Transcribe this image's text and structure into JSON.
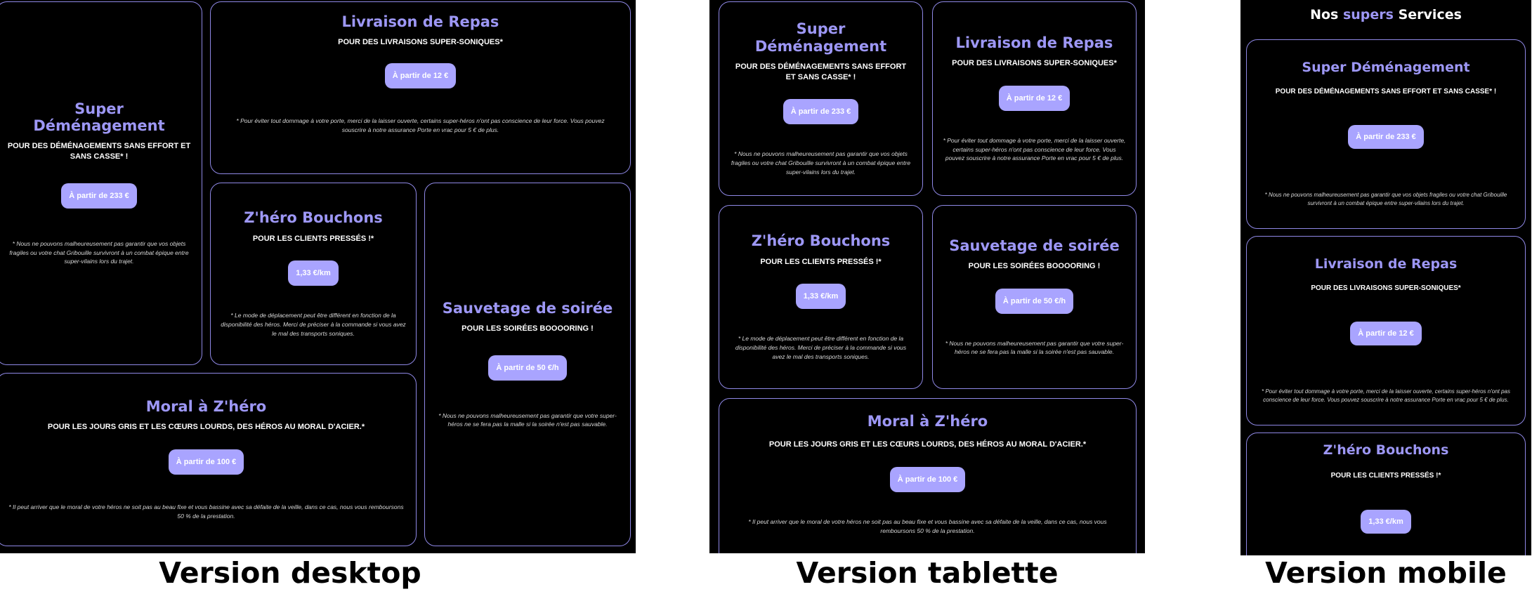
{
  "services": {
    "demenagement": {
      "title": "Super Déménagement",
      "subtitle": "POUR DES DÉMÉNAGEMENTS SANS EFFORT ET SANS CASSE* !",
      "price": "À partir de 233 €",
      "note": "* Nous ne pouvons malheureusement pas garantir que vos objets fragiles ou votre chat Gribouille survivront à un combat épique entre super-vilains lors du trajet."
    },
    "livraison": {
      "title": "Livraison de Repas",
      "subtitle": "POUR DES LIVRAISONS SUPER-SONIQUES*",
      "price": "À partir de 12 €",
      "note": "* Pour éviter tout dommage à votre porte, merci de la laisser ouverte, certains super-héros n'ont pas conscience de leur force. Vous pouvez souscrire à notre assurance Porte en vrac pour 5 € de plus."
    },
    "bouchons": {
      "title": "Z'héro Bouchons",
      "subtitle": "POUR LES CLIENTS PRESSÉS !*",
      "price": "1,33 €/km",
      "note": "* Le mode de déplacement peut être différent en fonction de la disponibilité des héros. Merci de préciser à la commande si vous avez le mal des transports soniques."
    },
    "soiree": {
      "title": "Sauvetage de soirée",
      "subtitle": "POUR LES SOIRÉES BOOOORING !",
      "price": "À partir de 50 €/h",
      "note": "* Nous ne pouvons malheureusement pas garantir que votre super-héros ne se fera pas la malle si la soirée n'est pas sauvable."
    },
    "moral": {
      "title": "Moral à Z'héro",
      "subtitle": "POUR LES JOURS GRIS ET LES CŒURS LOURDS, DES HÉROS AU MORAL D'ACIER.*",
      "price": "À partir de 100 €",
      "note": "* Il peut arriver que le moral de votre héros ne soit pas au beau fixe et vous bassine avec sa défaite de la veille, dans ce cas, nous vous remboursons 50 % de la prestation."
    }
  },
  "mobile_heading": {
    "part1": "Nos",
    "part2": "supers",
    "part3": "Services"
  },
  "captions": {
    "desktop": "Version desktop",
    "tablet": "Version tablette",
    "mobile": "Version mobile"
  },
  "colors": {
    "accent": "#9d97f5",
    "button": "#a9a4ff",
    "border": "#8f88e6",
    "background": "#000000"
  }
}
